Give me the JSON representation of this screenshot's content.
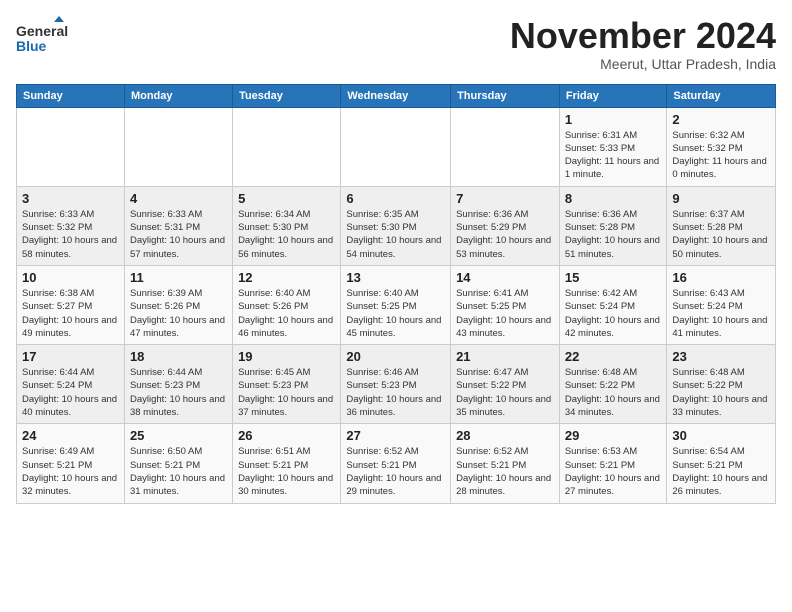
{
  "header": {
    "logo_general": "General",
    "logo_blue": "Blue",
    "month_title": "November 2024",
    "subtitle": "Meerut, Uttar Pradesh, India"
  },
  "calendar": {
    "days_of_week": [
      "Sunday",
      "Monday",
      "Tuesday",
      "Wednesday",
      "Thursday",
      "Friday",
      "Saturday"
    ],
    "weeks": [
      [
        {
          "day": "",
          "info": ""
        },
        {
          "day": "",
          "info": ""
        },
        {
          "day": "",
          "info": ""
        },
        {
          "day": "",
          "info": ""
        },
        {
          "day": "",
          "info": ""
        },
        {
          "day": "1",
          "info": "Sunrise: 6:31 AM\nSunset: 5:33 PM\nDaylight: 11 hours and 1 minute."
        },
        {
          "day": "2",
          "info": "Sunrise: 6:32 AM\nSunset: 5:32 PM\nDaylight: 11 hours and 0 minutes."
        }
      ],
      [
        {
          "day": "3",
          "info": "Sunrise: 6:33 AM\nSunset: 5:32 PM\nDaylight: 10 hours and 58 minutes."
        },
        {
          "day": "4",
          "info": "Sunrise: 6:33 AM\nSunset: 5:31 PM\nDaylight: 10 hours and 57 minutes."
        },
        {
          "day": "5",
          "info": "Sunrise: 6:34 AM\nSunset: 5:30 PM\nDaylight: 10 hours and 56 minutes."
        },
        {
          "day": "6",
          "info": "Sunrise: 6:35 AM\nSunset: 5:30 PM\nDaylight: 10 hours and 54 minutes."
        },
        {
          "day": "7",
          "info": "Sunrise: 6:36 AM\nSunset: 5:29 PM\nDaylight: 10 hours and 53 minutes."
        },
        {
          "day": "8",
          "info": "Sunrise: 6:36 AM\nSunset: 5:28 PM\nDaylight: 10 hours and 51 minutes."
        },
        {
          "day": "9",
          "info": "Sunrise: 6:37 AM\nSunset: 5:28 PM\nDaylight: 10 hours and 50 minutes."
        }
      ],
      [
        {
          "day": "10",
          "info": "Sunrise: 6:38 AM\nSunset: 5:27 PM\nDaylight: 10 hours and 49 minutes."
        },
        {
          "day": "11",
          "info": "Sunrise: 6:39 AM\nSunset: 5:26 PM\nDaylight: 10 hours and 47 minutes."
        },
        {
          "day": "12",
          "info": "Sunrise: 6:40 AM\nSunset: 5:26 PM\nDaylight: 10 hours and 46 minutes."
        },
        {
          "day": "13",
          "info": "Sunrise: 6:40 AM\nSunset: 5:25 PM\nDaylight: 10 hours and 45 minutes."
        },
        {
          "day": "14",
          "info": "Sunrise: 6:41 AM\nSunset: 5:25 PM\nDaylight: 10 hours and 43 minutes."
        },
        {
          "day": "15",
          "info": "Sunrise: 6:42 AM\nSunset: 5:24 PM\nDaylight: 10 hours and 42 minutes."
        },
        {
          "day": "16",
          "info": "Sunrise: 6:43 AM\nSunset: 5:24 PM\nDaylight: 10 hours and 41 minutes."
        }
      ],
      [
        {
          "day": "17",
          "info": "Sunrise: 6:44 AM\nSunset: 5:24 PM\nDaylight: 10 hours and 40 minutes."
        },
        {
          "day": "18",
          "info": "Sunrise: 6:44 AM\nSunset: 5:23 PM\nDaylight: 10 hours and 38 minutes."
        },
        {
          "day": "19",
          "info": "Sunrise: 6:45 AM\nSunset: 5:23 PM\nDaylight: 10 hours and 37 minutes."
        },
        {
          "day": "20",
          "info": "Sunrise: 6:46 AM\nSunset: 5:23 PM\nDaylight: 10 hours and 36 minutes."
        },
        {
          "day": "21",
          "info": "Sunrise: 6:47 AM\nSunset: 5:22 PM\nDaylight: 10 hours and 35 minutes."
        },
        {
          "day": "22",
          "info": "Sunrise: 6:48 AM\nSunset: 5:22 PM\nDaylight: 10 hours and 34 minutes."
        },
        {
          "day": "23",
          "info": "Sunrise: 6:48 AM\nSunset: 5:22 PM\nDaylight: 10 hours and 33 minutes."
        }
      ],
      [
        {
          "day": "24",
          "info": "Sunrise: 6:49 AM\nSunset: 5:21 PM\nDaylight: 10 hours and 32 minutes."
        },
        {
          "day": "25",
          "info": "Sunrise: 6:50 AM\nSunset: 5:21 PM\nDaylight: 10 hours and 31 minutes."
        },
        {
          "day": "26",
          "info": "Sunrise: 6:51 AM\nSunset: 5:21 PM\nDaylight: 10 hours and 30 minutes."
        },
        {
          "day": "27",
          "info": "Sunrise: 6:52 AM\nSunset: 5:21 PM\nDaylight: 10 hours and 29 minutes."
        },
        {
          "day": "28",
          "info": "Sunrise: 6:52 AM\nSunset: 5:21 PM\nDaylight: 10 hours and 28 minutes."
        },
        {
          "day": "29",
          "info": "Sunrise: 6:53 AM\nSunset: 5:21 PM\nDaylight: 10 hours and 27 minutes."
        },
        {
          "day": "30",
          "info": "Sunrise: 6:54 AM\nSunset: 5:21 PM\nDaylight: 10 hours and 26 minutes."
        }
      ]
    ]
  }
}
